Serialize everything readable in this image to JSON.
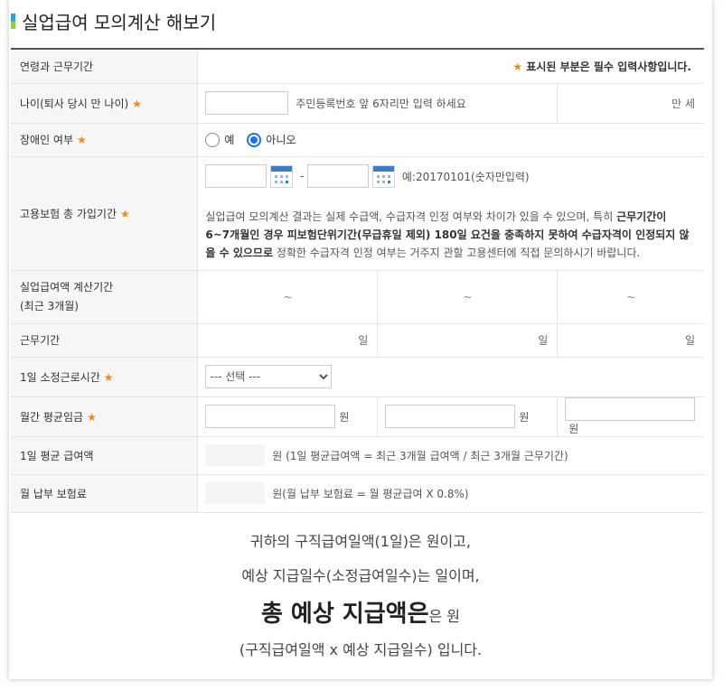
{
  "title": "실업급여 모의계산 해보기",
  "section_header": {
    "label": "연령과 근무기간",
    "required_note": "표시된 부분은 필수 입력사항입니다.",
    "required_star": "★"
  },
  "age": {
    "label": "나이(퇴사 당시 만 나이)",
    "value": "",
    "hint": "주민등록번호 앞 6자리만 입력 하세요",
    "unit": "만 세"
  },
  "disability": {
    "label": "장애인 여부",
    "options": [
      "예",
      "아니오"
    ],
    "selected": "아니오"
  },
  "insurance_period": {
    "label": "고용보험 총 가입기간",
    "date_sep": "-",
    "date_hint": "예:20170101(숫자만입력)",
    "notice_1": "실업급여 모의계산 결과는 실제 수급액, 수급자격 인정 여부와 차이가 있을 수 있으며, 특히 ",
    "notice_bold_1": "근무기간이 6~7개월인 경우 피보험단위기간(무급휴일 제외) 180일 요건을 충족하지 못하여 수급자격이 인정되지 않을 수 있으므로",
    "notice_2": " 정확한 수급자격 인정 여부는 거주지 관할 고용센터에 직접 문의하시기 바랍니다."
  },
  "calc_period": {
    "label_line1": "실업급여액 계산기간",
    "label_line2": "(최근 3개월)",
    "tilde": "~"
  },
  "work_days": {
    "label": "근무기간",
    "unit": "일"
  },
  "daily_hours": {
    "label": "1일 소정근로시간",
    "selected": "--- 선택 ---"
  },
  "monthly_wage": {
    "label": "월간 평균임금",
    "unit": "원"
  },
  "daily_avg": {
    "label": "1일 평균 급여액",
    "text": "원 (1일 평균급여액 = 최근 3개월 급여액 / 최근 3개월 근무기간)"
  },
  "monthly_premium": {
    "label": "월 납부 보험료",
    "text": "원(월 납부 보험료 = 월 평균급여 X 0.8%)"
  },
  "summary": {
    "line1": "귀하의 구직급여일액(1일)은 원이고,",
    "line2": "예상 지급일수(소정급여일수)는 일이며,",
    "line3_big": "총 예상 지급액은",
    "line3_small": "은 원",
    "line4": "(구직급여일액 x 예상 지급일수) 입니다."
  },
  "colors": {
    "accent_star": "#f08a1c",
    "radio_selected": "#1a73e8",
    "calendar": "#3a7ec9"
  }
}
